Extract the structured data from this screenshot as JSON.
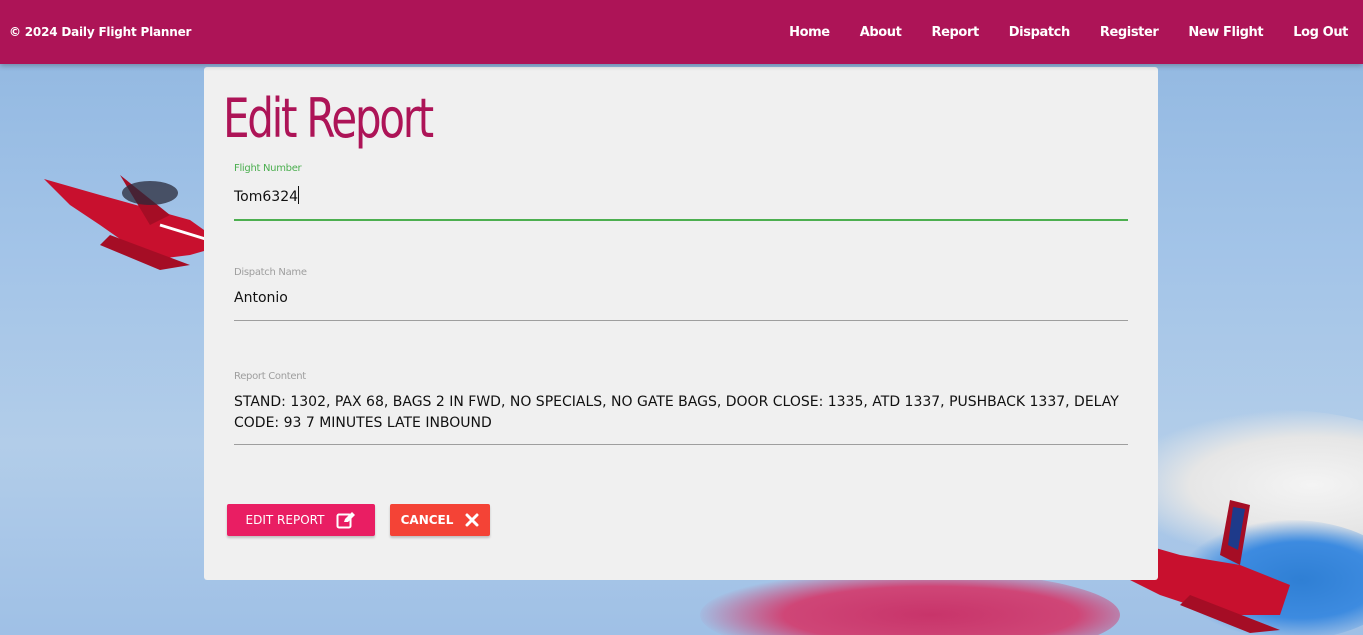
{
  "navbar": {
    "brand": "© 2024 Daily Flight Planner",
    "links": [
      "Home",
      "About",
      "Report",
      "Dispatch",
      "Register",
      "New Flight",
      "Log Out"
    ]
  },
  "form": {
    "title": "Edit Report",
    "flight_number": {
      "label": "Flight Number",
      "value": "Tom6324"
    },
    "dispatch_name": {
      "label": "Dispatch Name",
      "value": "Antonio"
    },
    "report_content": {
      "label": "Report Content",
      "value": "STAND: 1302, PAX 68, BAGS 2 IN FWD, NO SPECIALS, NO GATE BAGS, DOOR CLOSE: 1335, ATD 1337, PUSHBACK 1337, DELAY CODE: 93 7 MINUTES LATE INBOUND"
    },
    "buttons": {
      "edit_label": "EDIT REPORT",
      "edit_icon": "edit-icon",
      "cancel_label": "CANCEL",
      "cancel_icon": "close-icon"
    }
  },
  "colors": {
    "navbar": "#ad1457",
    "title": "#ad1457",
    "active_field": "#4caf50",
    "edit_button": "#e91e63",
    "cancel_button": "#f44336"
  }
}
